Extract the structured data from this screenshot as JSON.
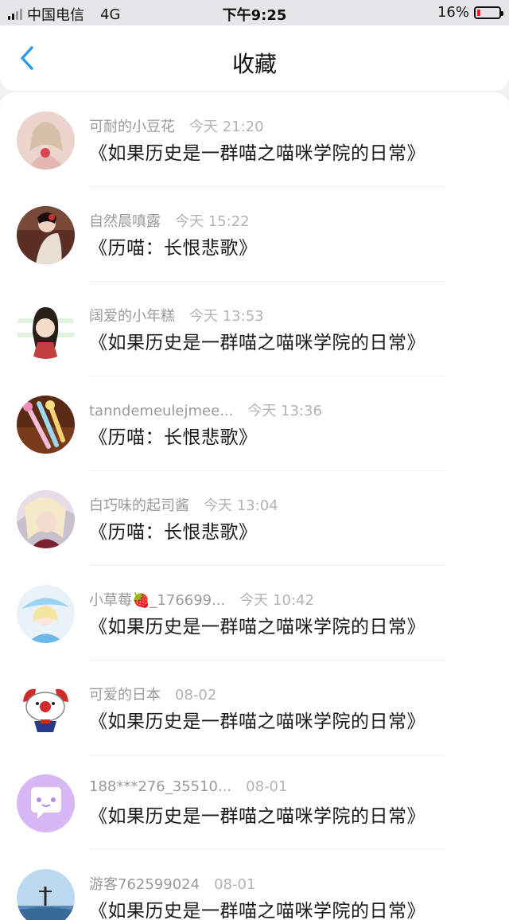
{
  "status_bar": {
    "carrier": "中国电信",
    "network": "4G",
    "time": "下午9:25",
    "battery_percent": "16%",
    "battery_level": 0.16
  },
  "nav": {
    "back_icon": "chevron-left-icon",
    "title": "收藏"
  },
  "colors": {
    "accent": "#2f9be8",
    "battery_low": "#e0262b"
  },
  "favorites": [
    {
      "user": "可耐的小豆花",
      "time": "今天 21:20",
      "title": "《如果历史是一群喵之喵咪学院的日常》"
    },
    {
      "user": "自然晨嗔露",
      "time": "今天 15:22",
      "title": "《历喵：长恨悲歌》"
    },
    {
      "user": "阔爱的小年糕",
      "time": "今天 13:53",
      "title": "《如果历史是一群喵之喵咪学院的日常》"
    },
    {
      "user": "tanndemeulejmee...",
      "time": "今天 13:36",
      "title": "《历喵：长恨悲歌》"
    },
    {
      "user": "白巧味的起司酱",
      "time": "今天 13:04",
      "title": "《历喵：长恨悲歌》"
    },
    {
      "user": "小草莓🍓_176699...",
      "time": "今天 10:42",
      "title": "《如果历史是一群喵之喵咪学院的日常》"
    },
    {
      "user": "可爱的日本",
      "time": "08-02",
      "title": "《如果历史是一群喵之喵咪学院的日常》"
    },
    {
      "user": "188***276_35510...",
      "time": "08-01",
      "title": "《如果历史是一群喵之喵咪学院的日常》"
    },
    {
      "user": "游客762599024",
      "time": "08-01",
      "title": "《如果历史是一群喵之喵咪学院的日常》"
    }
  ]
}
